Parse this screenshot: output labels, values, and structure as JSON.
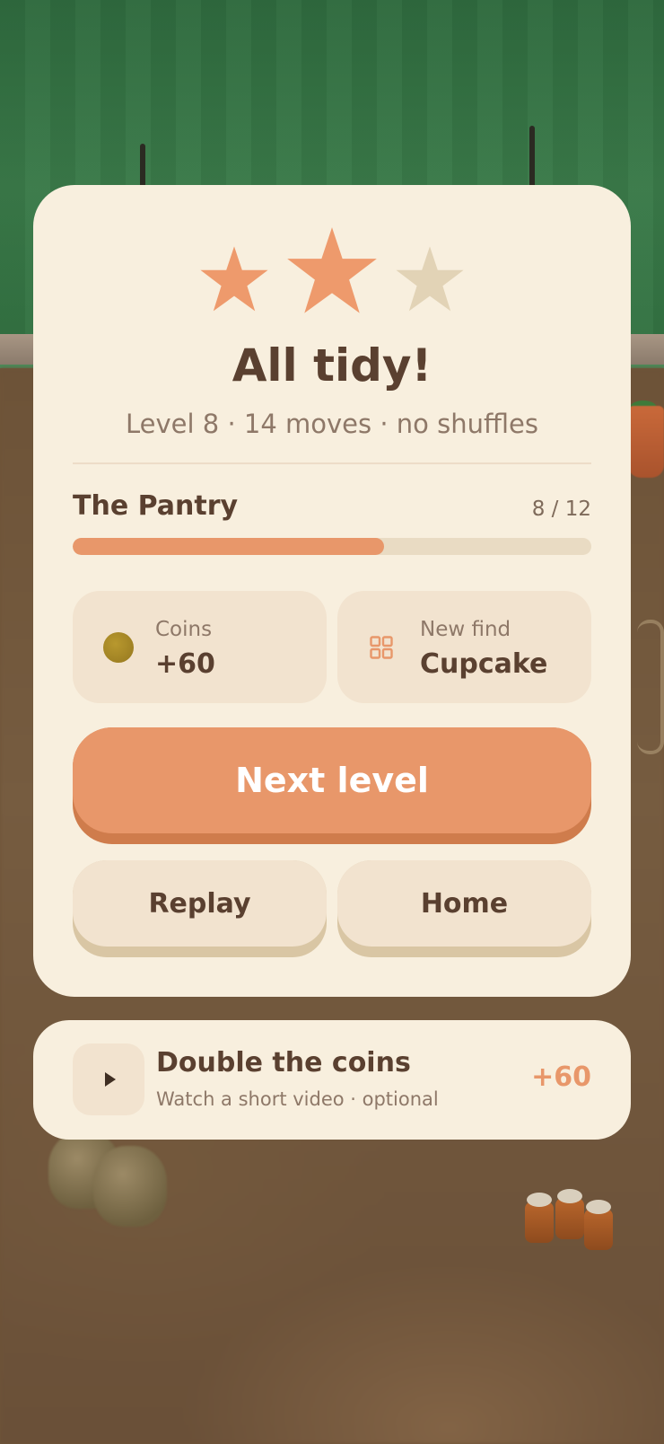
{
  "stars": {
    "earned": 2,
    "total": 3
  },
  "result": {
    "title": "All tidy!",
    "summary": "Level 8 · 14 moves · no shuffles"
  },
  "collection": {
    "name": "The Pantry",
    "count_label": "8 / 12",
    "progress": 0.6
  },
  "rewards": {
    "coins_label": "Coins",
    "coins_value": "+60",
    "find_label": "New find",
    "find_value": "Cupcake"
  },
  "buttons": {
    "next_label": "Next level",
    "replay_label": "Replay",
    "home_label": "Home"
  },
  "ad": {
    "title": "Double the coins",
    "subtitle": "Watch a short video · optional",
    "reward": "+60"
  },
  "icons": {
    "star_earned": "star-filled",
    "star_empty": "star-empty",
    "coins": "coin-icon",
    "find": "grid-icon",
    "play": "play-icon"
  },
  "colors": {
    "accent": "#e8976a",
    "star_filled": "#ee9a6c",
    "star_empty": "#e2d3b6",
    "text_dark": "#5a4030",
    "text_muted": "#8e7868",
    "card_bg": "#f8efde"
  }
}
